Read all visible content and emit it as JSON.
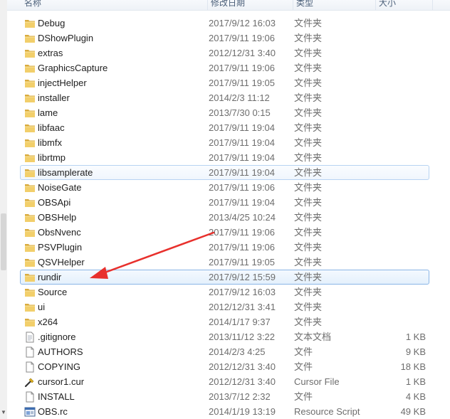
{
  "header": {
    "name": "名称",
    "date": "修改日期",
    "type": "类型",
    "size": "大小"
  },
  "rows": [
    {
      "name": "Debug",
      "date": "2017/9/12 16:03",
      "type": "文件夹",
      "size": "",
      "kind": "folder",
      "state": ""
    },
    {
      "name": "DShowPlugin",
      "date": "2017/9/11 19:06",
      "type": "文件夹",
      "size": "",
      "kind": "folder",
      "state": ""
    },
    {
      "name": "extras",
      "date": "2012/12/31 3:40",
      "type": "文件夹",
      "size": "",
      "kind": "folder",
      "state": ""
    },
    {
      "name": "GraphicsCapture",
      "date": "2017/9/11 19:06",
      "type": "文件夹",
      "size": "",
      "kind": "folder",
      "state": ""
    },
    {
      "name": "injectHelper",
      "date": "2017/9/11 19:05",
      "type": "文件夹",
      "size": "",
      "kind": "folder",
      "state": ""
    },
    {
      "name": "installer",
      "date": "2014/2/3 11:12",
      "type": "文件夹",
      "size": "",
      "kind": "folder",
      "state": ""
    },
    {
      "name": "lame",
      "date": "2013/7/30 0:15",
      "type": "文件夹",
      "size": "",
      "kind": "folder",
      "state": ""
    },
    {
      "name": "libfaac",
      "date": "2017/9/11 19:04",
      "type": "文件夹",
      "size": "",
      "kind": "folder",
      "state": ""
    },
    {
      "name": "libmfx",
      "date": "2017/9/11 19:04",
      "type": "文件夹",
      "size": "",
      "kind": "folder",
      "state": ""
    },
    {
      "name": "librtmp",
      "date": "2017/9/11 19:04",
      "type": "文件夹",
      "size": "",
      "kind": "folder",
      "state": ""
    },
    {
      "name": "libsamplerate",
      "date": "2017/9/11 19:04",
      "type": "文件夹",
      "size": "",
      "kind": "folder",
      "state": "hover"
    },
    {
      "name": "NoiseGate",
      "date": "2017/9/11 19:06",
      "type": "文件夹",
      "size": "",
      "kind": "folder",
      "state": ""
    },
    {
      "name": "OBSApi",
      "date": "2017/9/11 19:04",
      "type": "文件夹",
      "size": "",
      "kind": "folder",
      "state": ""
    },
    {
      "name": "OBSHelp",
      "date": "2013/4/25 10:24",
      "type": "文件夹",
      "size": "",
      "kind": "folder",
      "state": ""
    },
    {
      "name": "ObsNvenc",
      "date": "2017/9/11 19:06",
      "type": "文件夹",
      "size": "",
      "kind": "folder",
      "state": ""
    },
    {
      "name": "PSVPlugin",
      "date": "2017/9/11 19:06",
      "type": "文件夹",
      "size": "",
      "kind": "folder",
      "state": ""
    },
    {
      "name": "QSVHelper",
      "date": "2017/9/11 19:05",
      "type": "文件夹",
      "size": "",
      "kind": "folder",
      "state": ""
    },
    {
      "name": "rundir",
      "date": "2017/9/12 15:59",
      "type": "文件夹",
      "size": "",
      "kind": "folder",
      "state": "selected"
    },
    {
      "name": "Source",
      "date": "2017/9/12 16:03",
      "type": "文件夹",
      "size": "",
      "kind": "folder",
      "state": ""
    },
    {
      "name": "ui",
      "date": "2012/12/31 3:41",
      "type": "文件夹",
      "size": "",
      "kind": "folder",
      "state": ""
    },
    {
      "name": "x264",
      "date": "2014/1/17 9:37",
      "type": "文件夹",
      "size": "",
      "kind": "folder",
      "state": ""
    },
    {
      "name": ".gitignore",
      "date": "2013/11/12 3:22",
      "type": "文本文档",
      "size": "1 KB",
      "kind": "text",
      "state": ""
    },
    {
      "name": "AUTHORS",
      "date": "2014/2/3 4:25",
      "type": "文件",
      "size": "9 KB",
      "kind": "file",
      "state": ""
    },
    {
      "name": "COPYING",
      "date": "2012/12/31 3:40",
      "type": "文件",
      "size": "18 KB",
      "kind": "file",
      "state": ""
    },
    {
      "name": "cursor1.cur",
      "date": "2012/12/31 3:40",
      "type": "Cursor File",
      "size": "1 KB",
      "kind": "cursor",
      "state": ""
    },
    {
      "name": "INSTALL",
      "date": "2013/7/12 2:32",
      "type": "文件",
      "size": "4 KB",
      "kind": "file",
      "state": ""
    },
    {
      "name": "OBS.rc",
      "date": "2014/1/19 13:19",
      "type": "Resource Script",
      "size": "49 KB",
      "kind": "rc",
      "state": ""
    }
  ],
  "icons": {
    "folder": "folder-icon",
    "text": "text-file-icon",
    "file": "file-icon",
    "cursor": "cursor-file-icon",
    "rc": "resource-script-icon"
  },
  "colors": {
    "selection_border": "#8ab5e6",
    "arrow": "#e8302c",
    "folder": "#e9c35a"
  }
}
